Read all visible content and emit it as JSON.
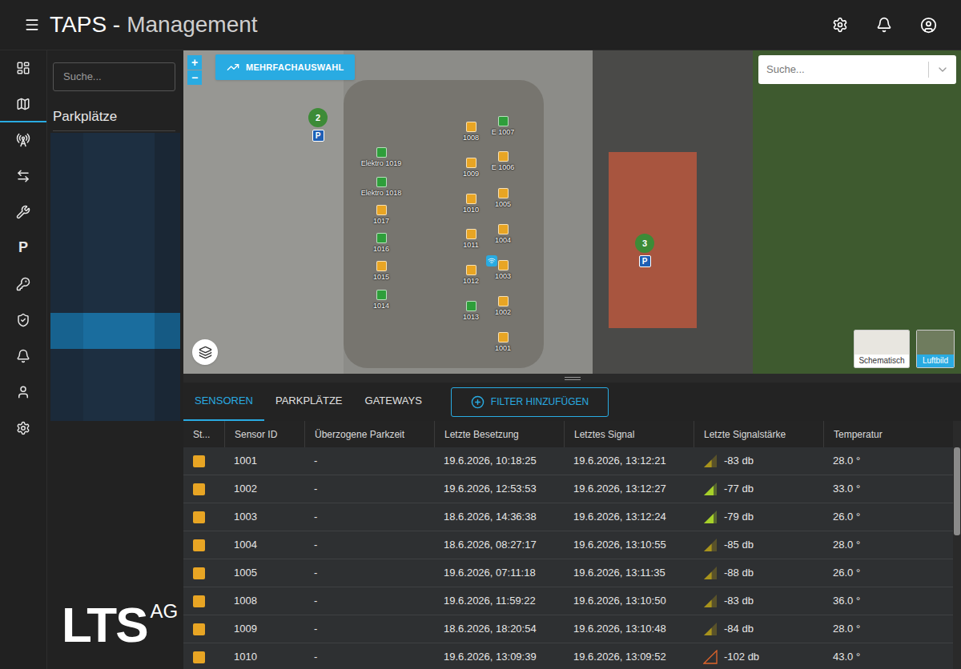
{
  "header": {
    "brand": "TAPS -",
    "subtitle": "Management"
  },
  "rail": [
    {
      "kind": "icon",
      "selected": false
    },
    {
      "kind": "icon",
      "selected": true
    },
    {
      "kind": "icon",
      "selected": false
    },
    {
      "kind": "icon",
      "selected": false
    },
    {
      "kind": "icon",
      "selected": false
    },
    {
      "kind": "text",
      "text": "P",
      "selected": false
    },
    {
      "kind": "icon",
      "selected": false
    },
    {
      "kind": "icon",
      "selected": false
    },
    {
      "kind": "icon",
      "selected": false
    },
    {
      "kind": "icon",
      "selected": false
    },
    {
      "kind": "icon",
      "selected": false
    }
  ],
  "sidebar": {
    "search_placeholder": "Suche...",
    "title": "Parkplätze",
    "list": [
      {
        "selected": false
      },
      {
        "selected": false
      },
      {
        "selected": false
      },
      {
        "selected": false
      },
      {
        "selected": false
      },
      {
        "selected": true
      },
      {
        "selected": false
      },
      {
        "selected": false
      }
    ]
  },
  "logo": {
    "name": "LTS",
    "suffix": "AG"
  },
  "map": {
    "zoom_in": "+",
    "zoom_out": "−",
    "multi_select": "MEHRFACHAUSWAHL",
    "search_placeholder": "Suche...",
    "clusters": [
      {
        "count": "2",
        "icon_text": "P"
      },
      {
        "count": "3",
        "icon_text": "P"
      }
    ],
    "sensors": [
      {
        "label": "Elektro 1019",
        "color": "#2e9e3a"
      },
      {
        "label": "Elektro 1018",
        "color": "#2e9e3a"
      },
      {
        "label": "1017",
        "color": "#e8a524"
      },
      {
        "label": "1016",
        "color": "#2e9e3a"
      },
      {
        "label": "1015",
        "color": "#e8a524"
      },
      {
        "label": "1014",
        "color": "#2e9e3a"
      },
      {
        "label": "1008",
        "color": "#e8a524"
      },
      {
        "label": "1009",
        "color": "#e8a524"
      },
      {
        "label": "1010",
        "color": "#e8a524"
      },
      {
        "label": "1011",
        "color": "#e8a524"
      },
      {
        "label": "1012",
        "color": "#e8a524"
      },
      {
        "label": "1013",
        "color": "#2e9e3a"
      },
      {
        "label": "E 1007",
        "color": "#2e9e3a"
      },
      {
        "label": "E 1006",
        "color": "#e8a524"
      },
      {
        "label": "1005",
        "color": "#e8a524"
      },
      {
        "label": "1004",
        "color": "#e8a524"
      },
      {
        "label": "1003",
        "color": "#e8a524"
      },
      {
        "label": "1002",
        "color": "#e8a524"
      },
      {
        "label": "1001",
        "color": "#e8a524"
      }
    ],
    "map_types": [
      {
        "label": "Schematisch",
        "selected": false
      },
      {
        "label": "Luftbild",
        "selected": true
      }
    ]
  },
  "tabs": [
    {
      "label": "SENSOREN",
      "selected": true
    },
    {
      "label": "PARKPLÄTZE",
      "selected": false
    },
    {
      "label": "GATEWAYS",
      "selected": false
    }
  ],
  "filter_button": "FILTER HINZUFÜGEN",
  "table": {
    "columns": [
      "St...",
      "Sensor ID",
      "Überzogene Parkzeit",
      "Letzte Besetzung",
      "Letztes Signal",
      "Letzte Signalstärke",
      "Temperatur"
    ],
    "rows": [
      {
        "status_color": "#e8a524",
        "sensor_id": "1001",
        "overdue": "-",
        "last_occupancy": "19.6.2026, 10:18:25",
        "last_signal": "19.6.2026, 13:12:21",
        "signal_strength": "-83 db",
        "signal": {
          "level": 0.6,
          "color": "#a8931c"
        },
        "temperature": "28.0 °"
      },
      {
        "status_color": "#e8a524",
        "sensor_id": "1002",
        "overdue": "-",
        "last_occupancy": "19.6.2026, 12:53:53",
        "last_signal": "19.6.2026, 13:12:27",
        "signal_strength": "-77 db",
        "signal": {
          "level": 0.75,
          "color": "#a6d12a"
        },
        "temperature": "33.0 °"
      },
      {
        "status_color": "#e8a524",
        "sensor_id": "1003",
        "overdue": "-",
        "last_occupancy": "18.6.2026, 14:36:38",
        "last_signal": "19.6.2026, 13:12:24",
        "signal_strength": "-79 db",
        "signal": {
          "level": 0.75,
          "color": "#a6d12a"
        },
        "temperature": "26.0 °"
      },
      {
        "status_color": "#e8a524",
        "sensor_id": "1004",
        "overdue": "-",
        "last_occupancy": "18.6.2026, 08:27:17",
        "last_signal": "19.6.2026, 13:10:55",
        "signal_strength": "-85 db",
        "signal": {
          "level": 0.6,
          "color": "#a8931c"
        },
        "temperature": "28.0 °"
      },
      {
        "status_color": "#e8a524",
        "sensor_id": "1005",
        "overdue": "-",
        "last_occupancy": "19.6.2026, 07:11:18",
        "last_signal": "19.6.2026, 13:11:35",
        "signal_strength": "-88 db",
        "signal": {
          "level": 0.6,
          "color": "#a8931c"
        },
        "temperature": "26.0 °"
      },
      {
        "status_color": "#e8a524",
        "sensor_id": "1008",
        "overdue": "-",
        "last_occupancy": "19.6.2026, 11:59:22",
        "last_signal": "19.6.2026, 13:10:50",
        "signal_strength": "-83 db",
        "signal": {
          "level": 0.6,
          "color": "#a8931c"
        },
        "temperature": "36.0 °"
      },
      {
        "status_color": "#e8a524",
        "sensor_id": "1009",
        "overdue": "-",
        "last_occupancy": "18.6.2026, 18:20:54",
        "last_signal": "19.6.2026, 13:10:48",
        "signal_strength": "-84 db",
        "signal": {
          "level": 0.6,
          "color": "#a8931c"
        },
        "temperature": "28.0 °"
      },
      {
        "status_color": "#e8a524",
        "sensor_id": "1010",
        "overdue": "-",
        "last_occupancy": "19.6.2026, 13:09:39",
        "last_signal": "19.6.2026, 13:09:52",
        "signal_strength": "-102 db",
        "signal": {
          "level": 0,
          "color": "#e0642a"
        },
        "temperature": "43.0 °"
      }
    ]
  }
}
